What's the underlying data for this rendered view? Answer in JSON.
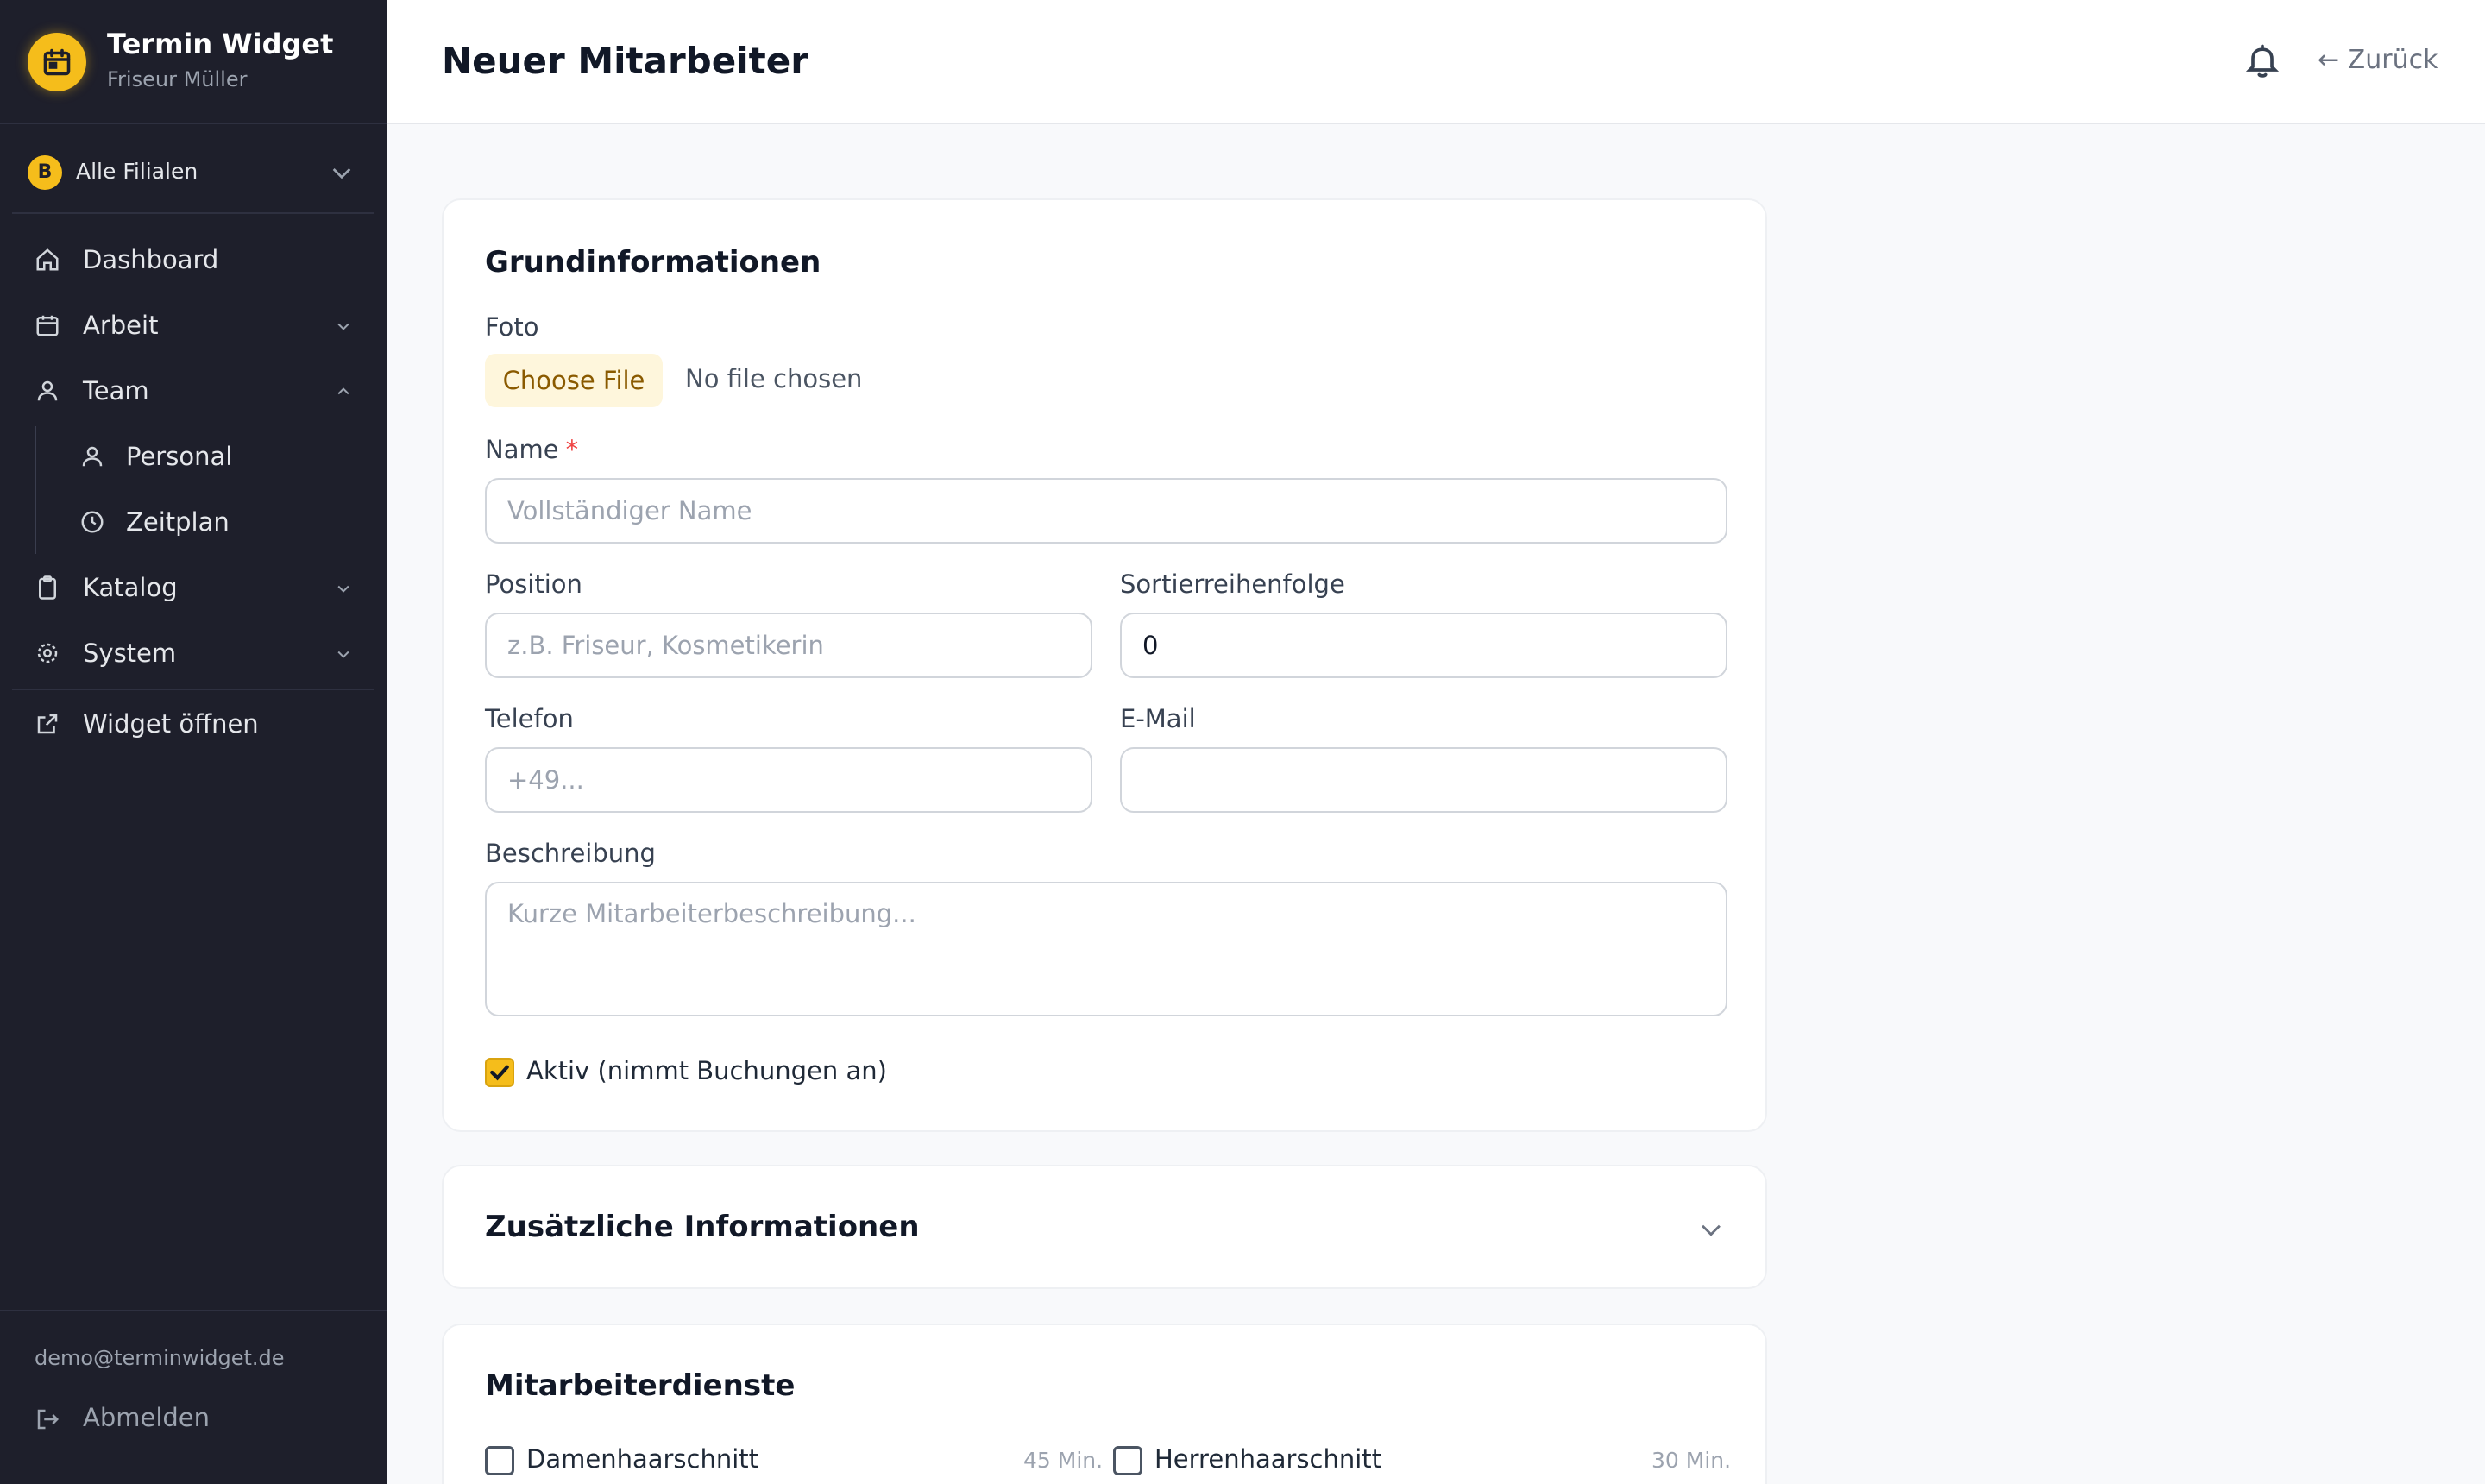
{
  "brand": {
    "title": "Termin Widget",
    "subtitle": "Friseur Müller",
    "accent": "#f5bd1b"
  },
  "branch": {
    "badge": "B",
    "label": "Alle Filialen"
  },
  "nav": {
    "dashboard": "Dashboard",
    "arbeit": "Arbeit",
    "team": "Team",
    "personal": "Personal",
    "zeitplan": "Zeitplan",
    "katalog": "Katalog",
    "system": "System",
    "widget": "Widget öffnen"
  },
  "user": {
    "email": "demo@terminwidget.de",
    "logout": "Abmelden"
  },
  "header": {
    "title": "Neuer Mitarbeiter",
    "back": "← Zurück"
  },
  "basic": {
    "title": "Grundinformationen",
    "photo_label": "Foto",
    "file_button": "Choose File",
    "file_status": "No file chosen",
    "name_label": "Name",
    "name_required": "*",
    "name_placeholder": "Vollständiger Name",
    "position_label": "Position",
    "position_placeholder": "z.B. Friseur, Kosmetikerin",
    "sort_label": "Sortierreihenfolge",
    "sort_value": "0",
    "phone_label": "Telefon",
    "phone_placeholder": "+49...",
    "email_label": "E-Mail",
    "email_value": "",
    "desc_label": "Beschreibung",
    "desc_placeholder": "Kurze Mitarbeiterbeschreibung...",
    "active_label": "Aktiv (nimmt Buchungen an)"
  },
  "additional": {
    "title": "Zusätzliche Informationen"
  },
  "services": {
    "title": "Mitarbeiterdienste",
    "items": [
      {
        "name": "Damenhaarschnitt",
        "duration": "45 Min."
      },
      {
        "name": "Herrenhaarschnitt",
        "duration": "30 Min."
      }
    ]
  }
}
